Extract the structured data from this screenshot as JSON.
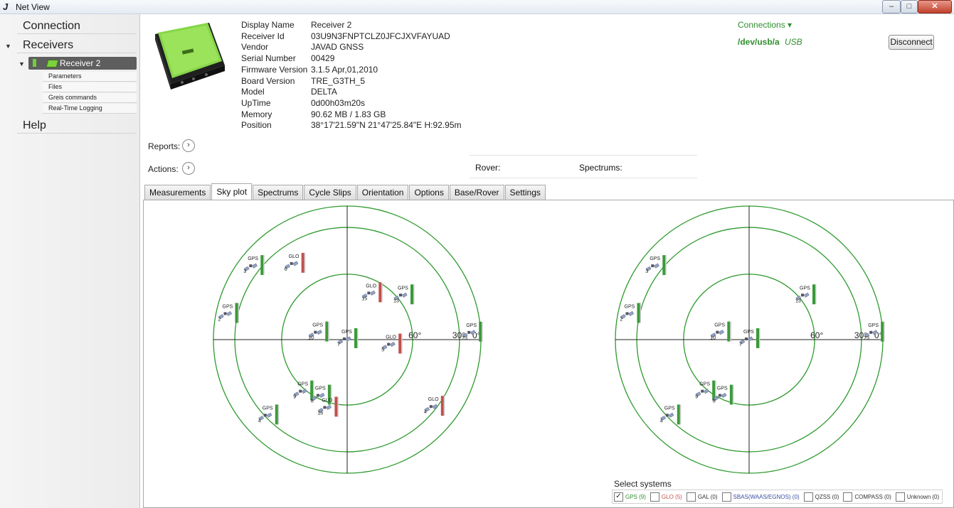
{
  "window": {
    "title": "Net View",
    "min": "–",
    "max": "□",
    "close": "✕"
  },
  "nav": {
    "connection": "Connection",
    "receivers": "Receivers",
    "receiver": "Receiver 2",
    "subitems": [
      "Parameters",
      "Files",
      "Greis commands",
      "Real-Time Logging"
    ],
    "help": "Help"
  },
  "info": [
    {
      "k": "Display Name",
      "v": "Receiver 2"
    },
    {
      "k": "Receiver Id",
      "v": "03U9N3FNPTCLZ0JFCJXVFAYUAD"
    },
    {
      "k": "Vendor",
      "v": "JAVAD GNSS"
    },
    {
      "k": "Serial Number",
      "v": "00429"
    },
    {
      "k": "Firmware Version",
      "v": "3.1.5 Apr,01,2010"
    },
    {
      "k": "Board Version",
      "v": "TRE_G3TH_5"
    },
    {
      "k": "Model",
      "v": "DELTA"
    },
    {
      "k": "UpTime",
      "v": "0d00h03m20s"
    },
    {
      "k": "Memory",
      "v": "90.62 MB / 1.83 GB"
    },
    {
      "k": "Position",
      "v": "38°17'21.59\"N 21°47'25.84\"E H:92.95m"
    }
  ],
  "connections": {
    "label": "Connections ▾",
    "path": "/dev/usb/a",
    "type": "USB",
    "disconnect": "Disconnect"
  },
  "reports": "Reports:",
  "actions": "Actions:",
  "rover": "Rover:",
  "spectrums": "Spectrums:",
  "tabs": [
    "Measurements",
    "Sky plot",
    "Spectrums",
    "Cycle Slips",
    "Orientation",
    "Options",
    "Base/Rover",
    "Settings"
  ],
  "active_tab": "Sky plot",
  "colors": {
    "gps": "#3a9a3a",
    "glo": "#c0504d",
    "ring": "#2e9a2e",
    "axis": "#222222",
    "link": "#2f8f2f"
  },
  "skyplot_left": {
    "ring_labels": [
      "60°",
      "30°",
      "0°"
    ],
    "satellites": [
      {
        "sys": "GPS",
        "prn": "3",
        "az": 308,
        "el": 10
      },
      {
        "sys": "GLO",
        "prn": "6",
        "az": 325,
        "el": 28
      },
      {
        "sys": "GLO",
        "prn": "15",
        "az": 28,
        "el": 55
      },
      {
        "sys": "GPS",
        "prn": "13",
        "az": 52,
        "el": 42
      },
      {
        "sys": "GPS",
        "prn": "2",
        "az": 282,
        "el": 8
      },
      {
        "sys": "GPS",
        "prn": "10",
        "az": 283,
        "el": 70
      },
      {
        "sys": "GPS",
        "prn": "7",
        "az": 270,
        "el": 90
      },
      {
        "sys": "GLO",
        "prn": "5",
        "az": 97,
        "el": 60
      },
      {
        "sys": "GPS",
        "prn": "23",
        "az": 87,
        "el": 6
      },
      {
        "sys": "GPS",
        "prn": "9",
        "az": 220,
        "el": 44
      },
      {
        "sys": "GPS",
        "prn": "8",
        "az": 205,
        "el": 48
      },
      {
        "sys": "GLO",
        "prn": "16",
        "az": 196,
        "el": 42
      },
      {
        "sys": "GPS",
        "prn": "4",
        "az": 226,
        "el": 16
      },
      {
        "sys": "GLO",
        "prn": "4",
        "az": 128,
        "el": 16
      }
    ]
  },
  "skyplot_right": {
    "ring_labels": [
      "60°",
      "30°",
      "0°"
    ],
    "satellites": [
      {
        "sys": "GPS",
        "prn": "3",
        "az": 308,
        "el": 10
      },
      {
        "sys": "GPS",
        "prn": "13",
        "az": 52,
        "el": 42
      },
      {
        "sys": "GPS",
        "prn": "2",
        "az": 282,
        "el": 8
      },
      {
        "sys": "GPS",
        "prn": "10",
        "az": 283,
        "el": 70
      },
      {
        "sys": "GPS",
        "prn": "7",
        "az": 270,
        "el": 90
      },
      {
        "sys": "GPS",
        "prn": "23",
        "az": 87,
        "el": 6
      },
      {
        "sys": "GPS",
        "prn": "9",
        "az": 220,
        "el": 44
      },
      {
        "sys": "GPS",
        "prn": "8",
        "az": 205,
        "el": 48
      },
      {
        "sys": "GPS",
        "prn": "4",
        "az": 226,
        "el": 16
      }
    ]
  },
  "select_systems": {
    "title": "Select systems",
    "items": [
      {
        "label": "GPS (9)",
        "checked": true,
        "color": "#2f8f2f"
      },
      {
        "label": "GLO (5)",
        "checked": false,
        "color": "#c0504d"
      },
      {
        "label": "GAL (0)",
        "checked": false,
        "color": "#333333"
      },
      {
        "label": "SBAS(WAAS/EGNOS) (0)",
        "checked": false,
        "color": "#3a4fa0"
      },
      {
        "label": "QZSS (0)",
        "checked": false,
        "color": "#333333"
      },
      {
        "label": "COMPASS (0)",
        "checked": false,
        "color": "#333333"
      },
      {
        "label": "Unknown (0)",
        "checked": false,
        "color": "#333333"
      }
    ]
  }
}
